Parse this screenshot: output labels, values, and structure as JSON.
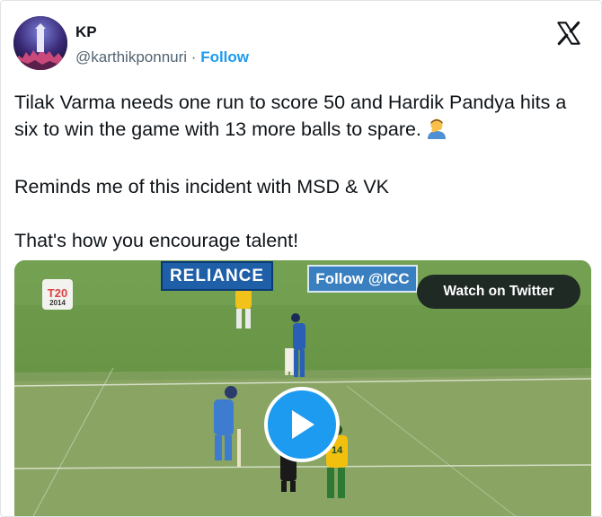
{
  "author": {
    "name": "KP",
    "handle": "@karthikponnuri",
    "separator": "·",
    "follow_label": "Follow"
  },
  "tweet": {
    "line1": "Tilak Varma needs one run to score 50 and Hardik Pandya hits a six to win the game with 13 more balls to spare.",
    "line2": "Reminds me of this incident with MSD & VK",
    "line3": "That's how you encourage talent!"
  },
  "video": {
    "board_left": "RELIANCE",
    "board_right": "Follow @ICC",
    "watch_label": "Watch on Twitter",
    "tournament_logo_top": "T20",
    "tournament_logo_year": "2014",
    "jersey_number": "14"
  },
  "colors": {
    "accent": "#1d9bf0",
    "text": "#0f1419",
    "secondary": "#536471"
  },
  "icons": {
    "brand": "x-logo-icon",
    "emoji": "man-facepalming-emoji",
    "play": "play-icon"
  }
}
